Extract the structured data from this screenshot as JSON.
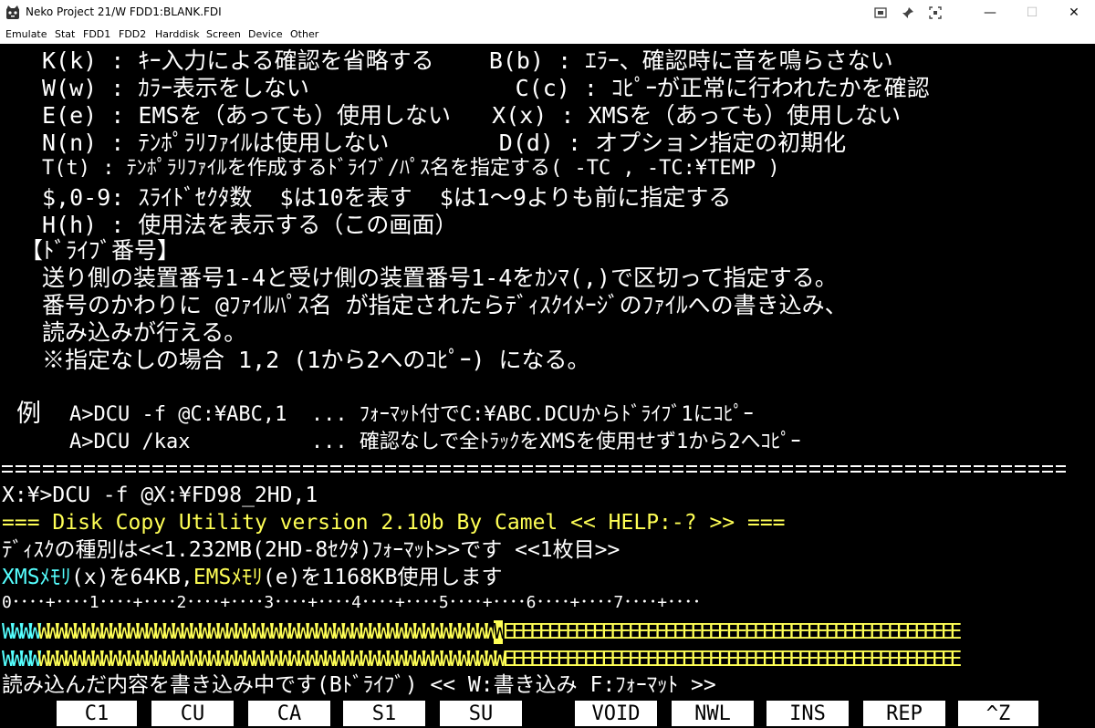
{
  "window": {
    "title": "Neko Project 21/W  FDD1:BLANK.FDI",
    "buttons": {
      "minimize": "—",
      "maximize": "☐",
      "close": "✕"
    },
    "extra_icons": [
      "screenshot-icon",
      "pin-icon",
      "fullscreen-icon"
    ]
  },
  "menu": [
    "Emulate",
    "Stat",
    "FDD1",
    "FDD2",
    "Harddisk",
    "Screen",
    "Device",
    "Other"
  ],
  "terminal": {
    "help_lines": [
      "K(k) : ｷｰ入力による確認を省略する    B(b) : ｴﾗｰ、確認時に音を鳴らさない",
      "W(w) : ｶﾗｰ表示をしない               C(c) : ｺﾋﾟｰが正常に行われたかを確認",
      "E(e) : EMSを（あっても）使用しない   X(x) : XMSを（あっても）使用しない",
      "N(n) : ﾃﾝﾎﾟﾗﾘﾌｧｲﾙは使用しない        D(d) : オプション指定の初期化",
      "T(t) : ﾃﾝﾎﾟﾗﾘﾌｧｲﾙを作成するﾄﾞﾗｲﾌﾞ/ﾊﾟｽ名を指定する( -TC , -TC:¥TEMP )",
      "$,0-9: ｽﾗｲﾄﾞｾｸﾀ数  $は10を表す  $は1～9よりも前に指定する",
      "H(h) : 使用法を表示する（この画面）"
    ],
    "drive_header": "【ﾄﾞﾗｲﾌﾞ番号】",
    "drive_lines": [
      "送り側の装置番号1-4と受け側の装置番号1-4をｶﾝﾏ(,)で区切って指定する。",
      "番号のかわりに @ﾌｧｲﾙﾊﾟｽ名 が指定されたらﾃﾞｨｽｸｲﾒｰｼﾞのﾌｧｲﾙへの書き込み、",
      "読み込みが行える。",
      "※指定なしの場合 1,2 (1から2へのｺﾋﾟｰ) になる。"
    ],
    "example_label": "例",
    "example_lines": [
      "A>DCU -f @C:¥ABC,1  ... ﾌｫｰﾏｯﾄ付でC:¥ABC.DCUからﾄﾞﾗｲﾌﾞ1にｺﾋﾟｰ",
      "A>DCU /kax          ... 確認なしで全ﾄﾗｯｸをXMSを使用せず1から2へｺﾋﾟｰ"
    ],
    "command_line": "X:¥>DCU -f @X:¥FD98_2HD,1",
    "banner": "=== Disk Copy Utility version 2.10b By Camel << HELP:-? >> ===",
    "disk_info": "ﾃﾞｨｽｸの種別は<<1.232MB(2HD-8ｾｸﾀ)ﾌｫｰﾏｯﾄ>>です <<1枚目>>",
    "memory_info": {
      "xms_label": "XMSﾒﾓﾘ",
      "xms_rest": "(x)を64KB,",
      "ems_label": "EMSﾒﾓﾘ",
      "ems_rest": "(e)を1168KB使用します"
    },
    "track_ruler": "0････+････1････+････2････+････3････+････4････+････5････+････6････+････7････+････",
    "track_rows": [
      {
        "done_cyan": "WWWW",
        "done_yellow": "WWWWWWWWWWWWWWWWWWWWWWWWWWWWWWWWWWWWWWWWWWWWWWWWWWW",
        "cursor": "W",
        "pending": "EEEEEEEEEEEEEEEEEEEEEEEEEEEEEEEEEEEEEEEEEEEEEEEEEEE"
      },
      {
        "done_cyan": "WWWW",
        "done_yellow": "WWWWWWWWWWWWWWWWWWWWWWWWWWWWWWWWWWWWWWWWWWWWWWWWWWW",
        "cursor": "W",
        "pending": "EEEEEEEEEEEEEEEEEEEEEEEEEEEEEEEEEEEEEEEEEEEEEEEEEEE"
      }
    ],
    "status_line": "読み込んだ内容を書き込み中です(Bﾄﾞﾗｲﾌﾞ) << W:書き込み F:ﾌｫｰﾏｯﾄ >>"
  },
  "function_keys": [
    "C1",
    "CU",
    "CA",
    "S1",
    "SU",
    "VOID",
    "NWL",
    "INS",
    "REP",
    "^Z"
  ]
}
